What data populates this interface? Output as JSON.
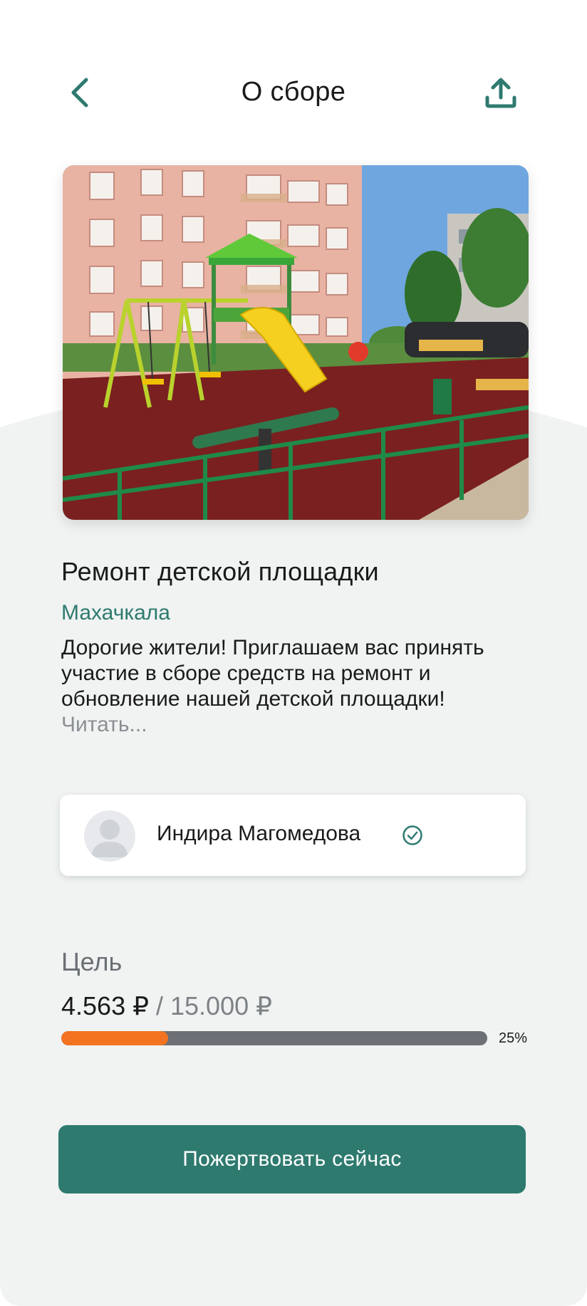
{
  "header": {
    "title": "О сборе"
  },
  "campaign": {
    "title": "Ремонт детской площадки",
    "city": "Махачкала",
    "description": "Дорогие жители! Приглашаем вас принять участие в сборе средств на ремонт и обновление нашей детской площадки! ",
    "read_more": "Читать..."
  },
  "author": {
    "name": "Индира Магомедова",
    "verified": true
  },
  "goal": {
    "label": "Цель",
    "raised": "4.563 ₽",
    "separator": " / ",
    "target": "15.000 ₽",
    "progress_percent": 25,
    "progress_label": "25%"
  },
  "actions": {
    "donate_label": "Пожертвовать сейчас"
  },
  "colors": {
    "accent": "#2e7a6f",
    "progress_fill": "#f47321",
    "progress_track": "#6d7075",
    "background_curve": "#f0f3f2"
  },
  "icons": {
    "back": "chevron-left-icon",
    "share": "upload-share-icon",
    "verified": "check-circle-icon",
    "avatar": "user-placeholder-icon"
  }
}
